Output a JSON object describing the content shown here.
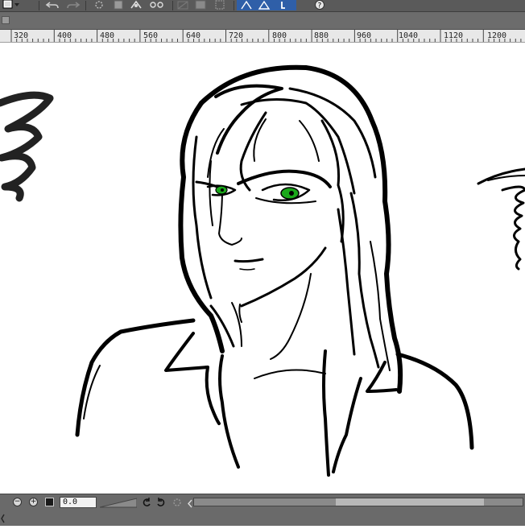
{
  "toolbar": {
    "icons": [
      "layer-color-icon",
      "dropdown-arrow-icon",
      "undo-icon",
      "redo-icon",
      "clear-icon",
      "cut-icon",
      "transform-icon",
      "fill-icon",
      "select-icon",
      "pen-setting-icon",
      "snap-icon",
      "help-icon"
    ]
  },
  "ruler": {
    "labels": [
      "320",
      "400",
      "480",
      "560",
      "640",
      "720",
      "800",
      "880",
      "960",
      "1040",
      "1120",
      "1200"
    ]
  },
  "statusbar": {
    "zoom_value": "0.0"
  },
  "colors": {
    "toolbar_bg": "#5a5a5a",
    "tab_bg": "#6c6c6c",
    "ruler_bg": "#e8e8e8",
    "canvas_bg": "#ffffff",
    "eye_green": "#1aa81a",
    "ink": "#000000",
    "accent_blue": "#2f5fa8"
  }
}
